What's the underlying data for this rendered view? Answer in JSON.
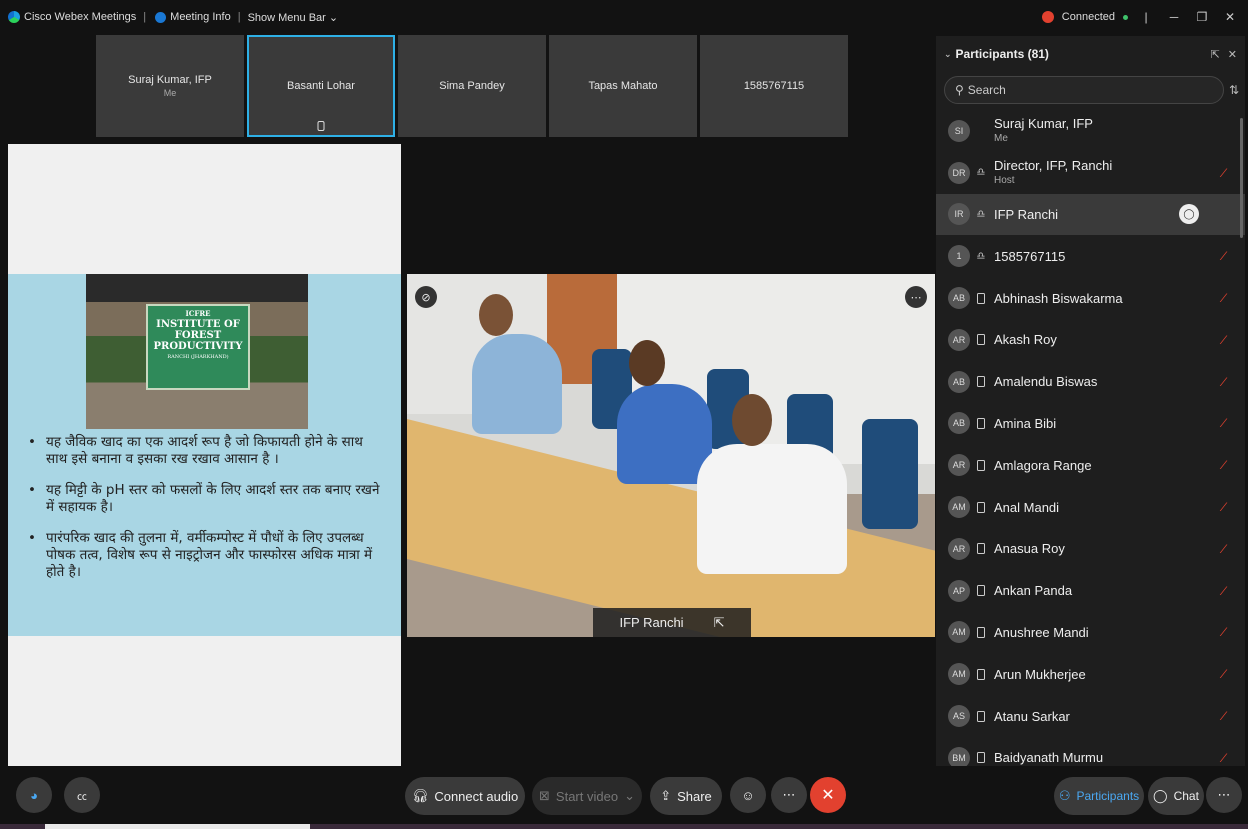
{
  "titlebar": {
    "app_name": "Cisco Webex Meetings",
    "meeting_info": "Meeting Info",
    "show_menu_bar": "Show Menu Bar",
    "status": "Connected"
  },
  "thumbnails": [
    {
      "name": "Suraj Kumar, IFP",
      "sub": "Me"
    },
    {
      "name": "Basanti Lohar",
      "sub": ""
    },
    {
      "name": "Sima Pandey",
      "sub": ""
    },
    {
      "name": "Tapas Mahato",
      "sub": ""
    },
    {
      "name": "1585767115",
      "sub": ""
    }
  ],
  "slide": {
    "sign": {
      "line1": "ICFRE",
      "line2": "INSTITUTE OF",
      "line3": "FOREST PRODUCTIVITY",
      "line4": "RANCHI (JHARKHAND)"
    },
    "bullets": [
      "यह जैविक खाद का एक आदर्श रूप है जो किफायती होने के साथ साथ इसे बनाना व इसका रख रखाव आसान है ।",
      "यह मिट्टी के pH स्तर को फसलों के लिए आदर्श स्तर तक बनाए रखने में सहायक है।",
      "पारंपरिक खाद की तुलना में, वर्मीकम्पोस्ट में पौधों के लिए उपलब्ध पोषक तत्व, विशेष रूप से नाइट्रोजन और फास्फोरस अधिक मात्रा में होते है।"
    ]
  },
  "video": {
    "label": "IFP Ranchi"
  },
  "participants": {
    "title": "Participants (81)",
    "search_placeholder": "Search",
    "list": [
      {
        "initials": "SI",
        "name": "Suraj Kumar, IFP",
        "role": "Me",
        "device": "",
        "muted": false
      },
      {
        "initials": "DR",
        "name": "Director, IFP, Ranchi",
        "role": "Host",
        "device": "headset",
        "muted": true
      },
      {
        "initials": "IR",
        "name": "IFP Ranchi",
        "role": "",
        "device": "headset",
        "muted": false,
        "highlight": true
      },
      {
        "initials": "1",
        "name": "1585767115",
        "role": "",
        "device": "headset",
        "muted": true
      },
      {
        "initials": "AB",
        "name": "Abhinash Biswakarma",
        "role": "",
        "device": "phone",
        "muted": true
      },
      {
        "initials": "AR",
        "name": "Akash Roy",
        "role": "",
        "device": "phone",
        "muted": true
      },
      {
        "initials": "AB",
        "name": "Amalendu Biswas",
        "role": "",
        "device": "phone",
        "muted": true
      },
      {
        "initials": "AB",
        "name": "Amina Bibi",
        "role": "",
        "device": "phone",
        "muted": true
      },
      {
        "initials": "AR",
        "name": "Amlagora Range",
        "role": "",
        "device": "phone",
        "muted": true
      },
      {
        "initials": "AM",
        "name": "Anal Mandi",
        "role": "",
        "device": "phone",
        "muted": true
      },
      {
        "initials": "AR",
        "name": "Anasua Roy",
        "role": "",
        "device": "phone",
        "muted": true
      },
      {
        "initials": "AP",
        "name": "Ankan Panda",
        "role": "",
        "device": "phone",
        "muted": true
      },
      {
        "initials": "AM",
        "name": "Anushree Mandi",
        "role": "",
        "device": "phone",
        "muted": true
      },
      {
        "initials": "AM",
        "name": "Arun Mukherjee",
        "role": "",
        "device": "phone",
        "muted": true
      },
      {
        "initials": "AS",
        "name": "Atanu Sarkar",
        "role": "",
        "device": "phone",
        "muted": true
      },
      {
        "initials": "BM",
        "name": "Baidyanath Murmu",
        "role": "",
        "device": "phone",
        "muted": true
      }
    ]
  },
  "toolbar": {
    "connect_audio": "Connect audio",
    "start_video": "Start video",
    "share": "Share",
    "participants": "Participants",
    "chat": "Chat"
  },
  "icons": {
    "mute": "mic-muted-icon",
    "headset": "headset-icon",
    "phone": "phone-icon"
  },
  "colors": {
    "accent_red": "#e2412f",
    "accent_blue": "#4aa8f2",
    "active_thumb": "#2eb0e6"
  }
}
